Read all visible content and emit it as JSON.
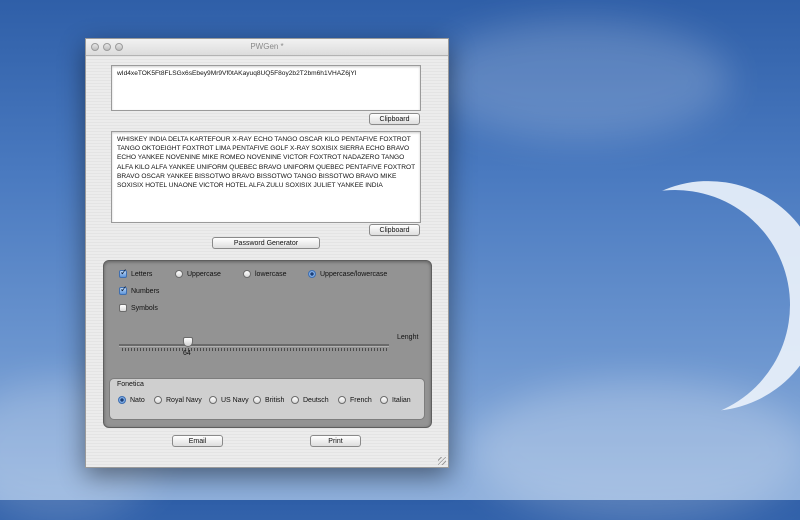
{
  "window": {
    "title": "PWGen *"
  },
  "password_field": {
    "value": "wId4xeTOK5Ft8FLSGx6sEbey9Mr9Vf0tAKayuq8UQ5F8oy2b2T2bm6h1VHAZ6jYI"
  },
  "clipboard_button_1": "Clipboard",
  "phonetic_field": {
    "value": " WHISKEY INDIA DELTA KARTEFOUR X-RAY ECHO TANGO OSCAR KILO PENTAFIVE FOXTROT TANGO OKTOEIGHT FOXTROT LIMA PENTAFIVE GOLF X-RAY SOXISIX SIERRA ECHO BRAVO ECHO YANKEE NOVENINE MIKE ROMEO NOVENINE VICTOR FOXTROT NADAZERO TANGO ALFA KILO ALFA YANKEE UNIFORM QUEBEC BRAVO UNIFORM QUEBEC PENTAFIVE FOXTROT BRAVO OSCAR YANKEE BISSOTWO BRAVO BISSOTWO TANGO BISSOTWO BRAVO MIKE SOXISIX HOTEL UNAONE VICTOR HOTEL ALFA ZULU SOXISIX JULIET YANKEE INDIA"
  },
  "clipboard_button_2": "Clipboard",
  "generate_button": "Password Generator",
  "options": {
    "letters": {
      "label": "Letters",
      "checked": true
    },
    "uppercase": {
      "label": "Uppercase",
      "checked": false
    },
    "lowercase": {
      "label": "lowercase",
      "checked": false
    },
    "upperlower": {
      "label": "Uppercase/lowercase",
      "checked": true
    },
    "numbers": {
      "label": "Numbers",
      "checked": true
    },
    "symbols": {
      "label": "Symbols",
      "checked": false
    }
  },
  "length": {
    "label": "Lenght",
    "value": "64"
  },
  "fonetica": {
    "label": "Fonetica",
    "options": [
      "Nato",
      "Royal Navy",
      "US Navy",
      "British",
      "Deutsch",
      "French",
      "Italian"
    ],
    "selected": "Nato"
  },
  "email_button": "Email",
  "print_button": "Print"
}
